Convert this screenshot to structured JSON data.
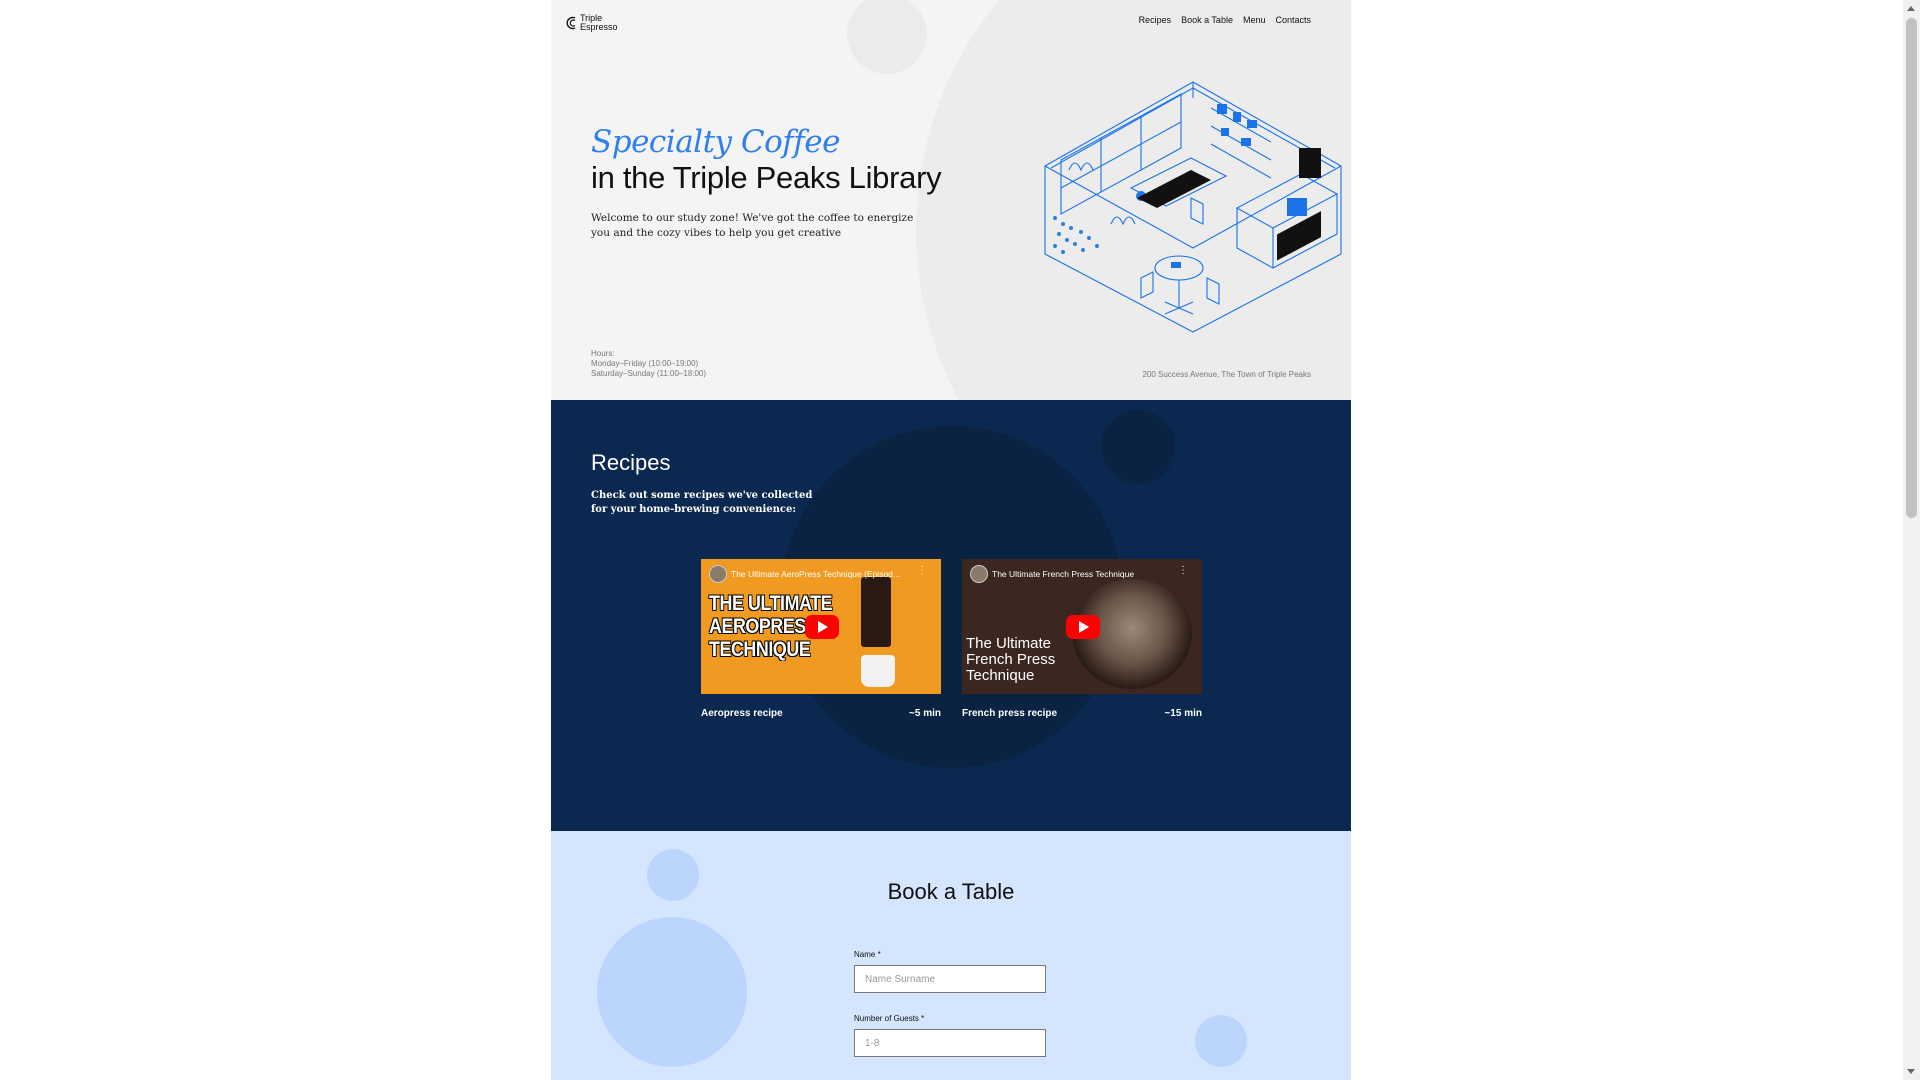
{
  "header": {
    "logo_line1": "Triple",
    "logo_line2": "Espresso",
    "nav": [
      "Recipes",
      "Book a Table",
      "Menu",
      "Contacts"
    ]
  },
  "hero": {
    "title_italic": "Specialty Coffee",
    "title_main": "in the Triple Peaks Library",
    "description": "Welcome to our study zone! We've got the coffee to energize you and the cozy vibes to help you get creative",
    "hours_label": "Hours:",
    "hours_weekdays": "Monday–Friday (10:00–19:00)",
    "hours_weekend": "Saturday–Sunday (11:00–18:00)",
    "address": "200 Success Avenue, The Town of Triple Peaks"
  },
  "recipes": {
    "title": "Recipes",
    "description": "Check out some recipes we've collected for your home-brewing convenience:",
    "videos": [
      {
        "video_title": "The Ultimate AeroPress Technique (Episod...",
        "thumb_text_lines": [
          "THE ULTIMATE",
          "AEROPRES",
          "TECHNIQUE"
        ],
        "caption": "Aeropress recipe",
        "duration": "~5 min"
      },
      {
        "video_title": "The Ultimate French Press Technique",
        "thumb_text_lines": [
          "The Ultimate",
          "French Press",
          "Technique"
        ],
        "caption": "French press recipe",
        "duration": "~15 min"
      }
    ]
  },
  "book": {
    "title": "Book a Table",
    "name_label": "Name *",
    "name_placeholder": "Name Surname",
    "guests_label": "Number of Guests *",
    "guests_placeholder": "1-8"
  },
  "colors": {
    "accent_blue": "#2f80ed",
    "recipes_bg": "#0b2850",
    "book_bg": "#d6e5fe",
    "youtube_red": "#ff0000"
  }
}
